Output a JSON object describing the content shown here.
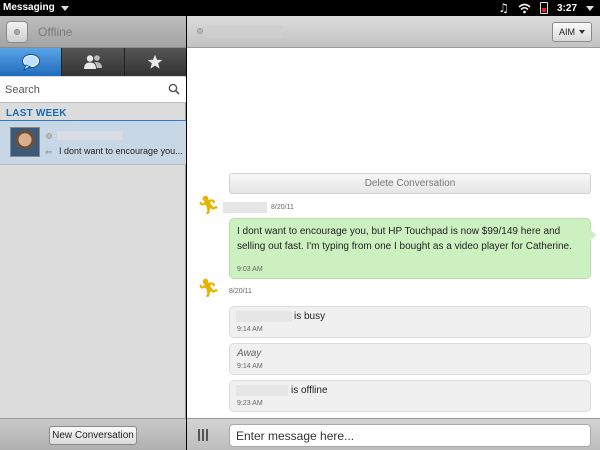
{
  "status_bar": {
    "app_name": "Messaging",
    "time": "3:27",
    "icons": [
      "music-note-icon",
      "wifi-icon",
      "battery-icon"
    ]
  },
  "sidebar": {
    "presence_status": "Offline",
    "tabs": [
      {
        "name": "conversations",
        "icon": "chat-bubble-icon",
        "active": true
      },
      {
        "name": "buddies",
        "icon": "buddies-icon",
        "active": false
      },
      {
        "name": "favorites",
        "icon": "star-icon",
        "active": false
      }
    ],
    "search_placeholder": "Search",
    "section_label": "LAST WEEK",
    "conversations": [
      {
        "preview": "I dont want to encourage you..."
      }
    ],
    "new_conversation_label": "New Conversation"
  },
  "conversation": {
    "service": "AIM",
    "delete_label": "Delete Conversation",
    "messages": [
      {
        "from": "me",
        "date": "8/20/11",
        "text": "I dont want to encourage you, but HP Touchpad is now $99/149 here and selling out fast. I'm typing from one I bought as a video player for Catherine.",
        "time": "9:03 AM"
      },
      {
        "from": "contact",
        "date": "8/20/11",
        "statuses": [
          {
            "text": "is busy",
            "time": "9:14 AM"
          },
          {
            "text": "Away",
            "time": "9:14 AM"
          },
          {
            "text": "is offline",
            "time": "9:23 AM"
          }
        ]
      }
    ],
    "compose_placeholder": "Enter message here..."
  },
  "colors": {
    "accent_blue": "#1f6cbd",
    "sent_bubble": "#cdf0c0",
    "status_bubble": "#f0f0f0",
    "aim_yellow": "#e6b400"
  }
}
